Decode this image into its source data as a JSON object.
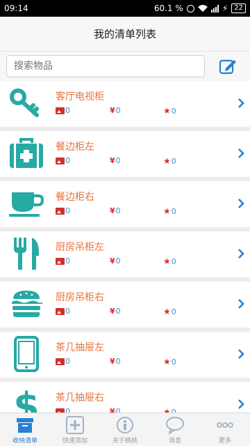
{
  "status": {
    "time": "09:14",
    "battery_pct": "60.1 %",
    "charge_num": "22"
  },
  "header": {
    "title": "我的清单列表"
  },
  "search": {
    "placeholder": "搜索物品"
  },
  "items": [
    {
      "name": "客厅电视柜",
      "icon": "key-icon",
      "photos": "0",
      "price": "0",
      "stars": "0"
    },
    {
      "name": "餐边柜左",
      "icon": "first-aid-kit-icon",
      "photos": "0",
      "price": "0",
      "stars": "0"
    },
    {
      "name": "餐边柜右",
      "icon": "coffee-cup-icon",
      "photos": "0",
      "price": "0",
      "stars": "0"
    },
    {
      "name": "厨房吊柜左",
      "icon": "fork-knife-icon",
      "photos": "0",
      "price": "0",
      "stars": "0"
    },
    {
      "name": "厨房吊柜右",
      "icon": "burger-icon",
      "photos": "0",
      "price": "0",
      "stars": "0"
    },
    {
      "name": "茶几抽屉左",
      "icon": "tablet-icon",
      "photos": "0",
      "price": "0",
      "stars": "0"
    },
    {
      "name": "茶几抽屉右",
      "icon": "dollar-icon",
      "photos": "0",
      "price": "0",
      "stars": "0"
    }
  ],
  "tabs": [
    {
      "label": "收纳清单",
      "icon": "box-icon"
    },
    {
      "label": "快速添加",
      "icon": "plus-icon"
    },
    {
      "label": "关于桃桃",
      "icon": "info-icon"
    },
    {
      "label": "消息",
      "icon": "chat-icon"
    },
    {
      "label": "更多",
      "icon": "more-icon"
    }
  ],
  "colors": {
    "accent": "#2a7fd2",
    "teal": "#27a9a4",
    "orange": "#e6723a",
    "red": "#d3302b"
  }
}
